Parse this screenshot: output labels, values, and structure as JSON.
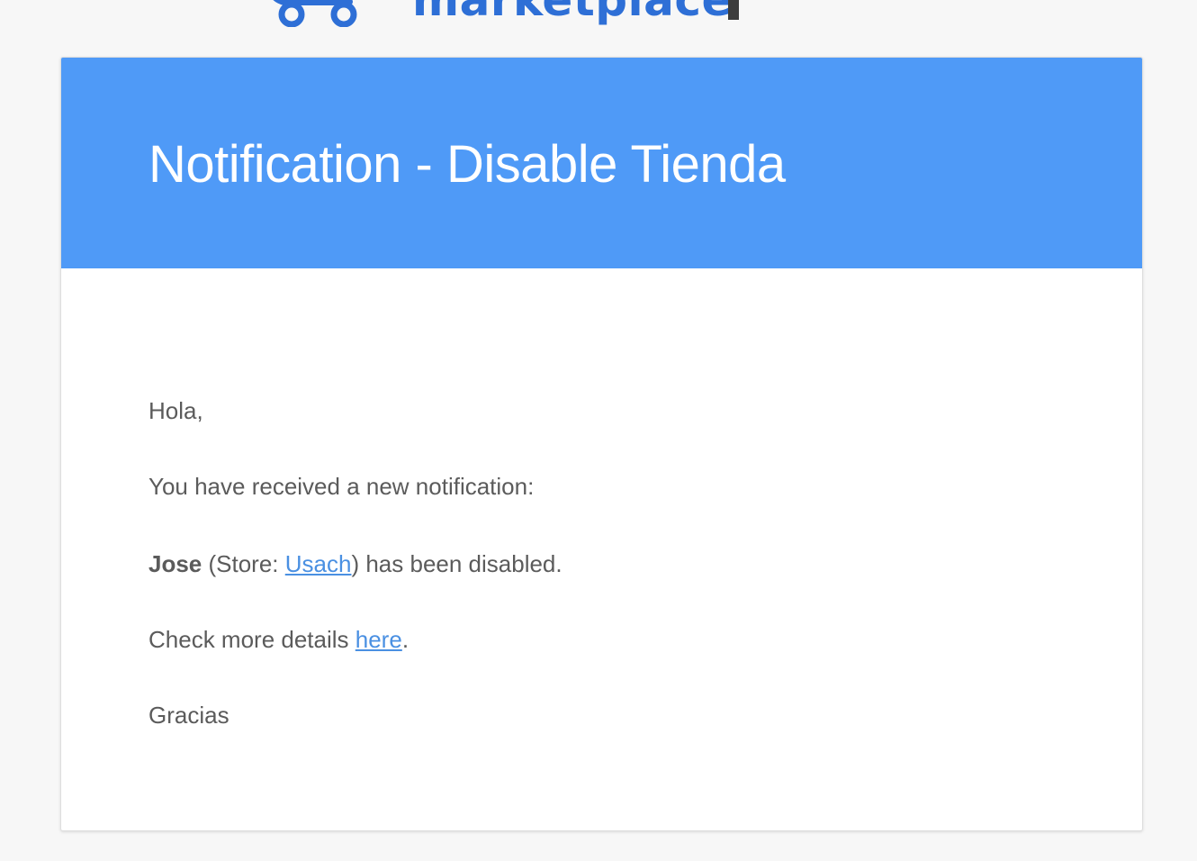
{
  "logo": {
    "text": "marketplace",
    "icon": "cart-wheels-icon",
    "brand_color": "#2e6fd6"
  },
  "email": {
    "header_color": "#4f9af7",
    "title": "Notification - Disable Tienda",
    "greeting": "Hola,",
    "intro": "You have received a new notification:",
    "user_name": "Jose",
    "store_prefix": " (Store: ",
    "store_link_text": "Usach",
    "store_suffix": ") has been disabled.",
    "details_prefix": "Check more details ",
    "details_link_text": "here",
    "details_suffix": ".",
    "closing": "Gracias",
    "link_color": "#4a90e2",
    "text_color": "#5b5b5b"
  }
}
